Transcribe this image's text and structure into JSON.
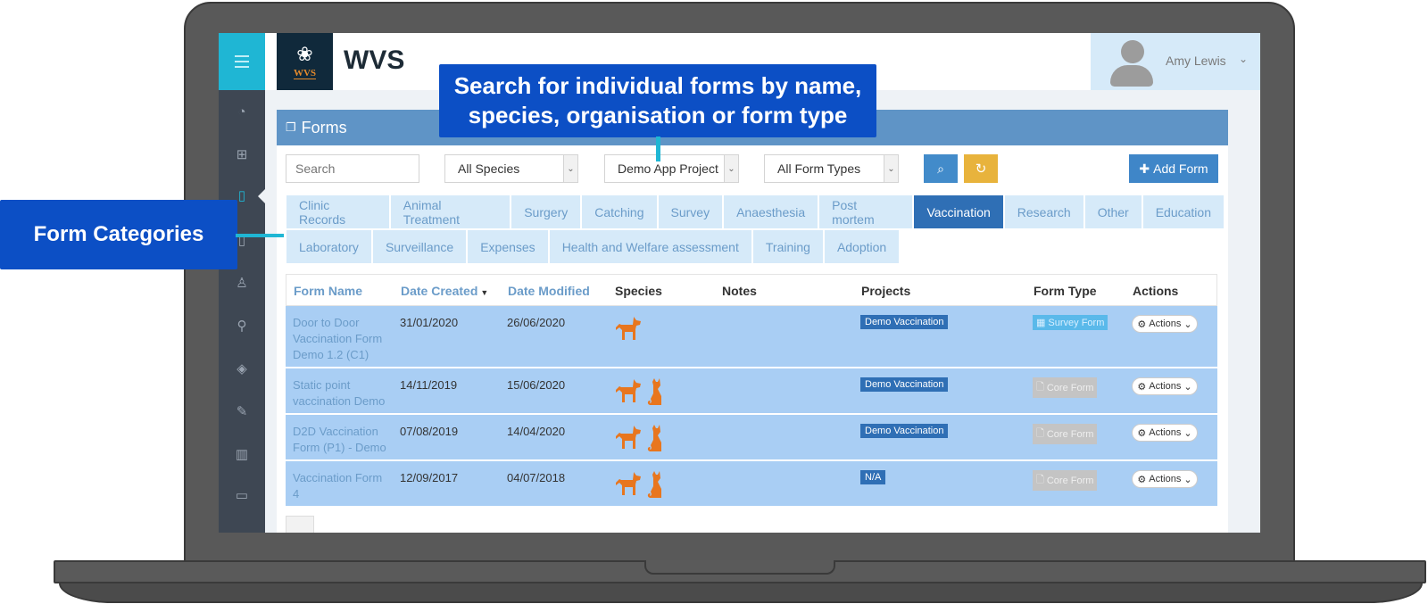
{
  "app": {
    "title": "WVS",
    "logo_text": "WVS"
  },
  "user": {
    "name": "Amy Lewis"
  },
  "panel": {
    "title": "Forms"
  },
  "filters": {
    "search_placeholder": "Search",
    "species": "All Species",
    "project": "Demo App Project",
    "form_type": "All Form Types",
    "add_label": "Add Form"
  },
  "tabs_row1": [
    "Clinic Records",
    "Animal Treatment",
    "Surgery",
    "Catching",
    "Survey",
    "Anaesthesia",
    "Post mortem",
    "Vaccination",
    "Research",
    "Other",
    "Education"
  ],
  "tabs_row2": [
    "Laboratory",
    "Surveillance",
    "Expenses",
    "Health and Welfare assessment",
    "Training",
    "Adoption"
  ],
  "active_tab": "Vaccination",
  "table": {
    "headers": {
      "name": "Form Name",
      "created": "Date Created",
      "modified": "Date Modified",
      "species": "Species",
      "notes": "Notes",
      "projects": "Projects",
      "form_type": "Form Type",
      "actions": "Actions"
    },
    "rows": [
      {
        "name": "Door to Door Vaccination Form Demo 1.2 (C1)",
        "created": "31/01/2020",
        "modified": "26/06/2020",
        "species": [
          "dog"
        ],
        "project": "Demo Vaccination",
        "form_type": "Survey Form",
        "form_type_kind": "survey",
        "actions": "Actions"
      },
      {
        "name": "Static point vaccination Demo",
        "created": "14/11/2019",
        "modified": "15/06/2020",
        "species": [
          "dog",
          "cat"
        ],
        "project": "Demo Vaccination",
        "form_type": "Core Form",
        "form_type_kind": "core",
        "actions": "Actions"
      },
      {
        "name": "D2D Vaccination Form (P1) - Demo",
        "created": "07/08/2019",
        "modified": "14/04/2020",
        "species": [
          "dog",
          "cat"
        ],
        "project": "Demo Vaccination",
        "form_type": "Core Form",
        "form_type_kind": "core",
        "actions": "Actions"
      },
      {
        "name": "Vaccination Form 4",
        "created": "12/09/2017",
        "modified": "04/07/2018",
        "species": [
          "dog",
          "cat"
        ],
        "project": "N/A",
        "form_type": "Core Form",
        "form_type_kind": "core",
        "actions": "Actions"
      }
    ]
  },
  "annotations": {
    "search_callout": "Search for individual forms by name, species, organisation or form type",
    "categories_callout": "Form Categories"
  },
  "colors": {
    "accent": "#1fb6d4",
    "callout": "#0c4fc5",
    "active_tab": "#2f6fb5",
    "species_icon": "#e8761e"
  }
}
